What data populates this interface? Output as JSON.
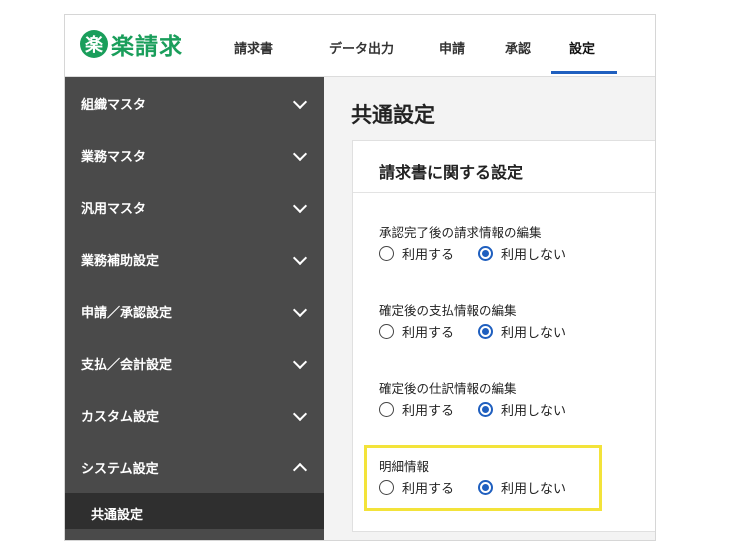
{
  "app": {
    "logo_mark": "楽",
    "logo_text": "楽請求",
    "brand_color": "#1a9e5b",
    "accent_color": "#1f5fbf"
  },
  "nav": {
    "items": [
      {
        "label": "請求書"
      },
      {
        "label": "データ出力"
      },
      {
        "label": "申請"
      },
      {
        "label": "承認"
      },
      {
        "label": "設定",
        "active": true
      }
    ]
  },
  "sidebar": {
    "items": [
      {
        "label": "組織マスタ",
        "icon": "chevron-down-icon"
      },
      {
        "label": "業務マスタ",
        "icon": "chevron-down-icon"
      },
      {
        "label": "汎用マスタ",
        "icon": "chevron-down-icon"
      },
      {
        "label": "業務補助設定",
        "icon": "chevron-down-icon"
      },
      {
        "label": "申請／承認設定",
        "icon": "chevron-down-icon"
      },
      {
        "label": "支払／会計設定",
        "icon": "chevron-down-icon"
      },
      {
        "label": "カスタム設定",
        "icon": "chevron-down-icon"
      },
      {
        "label": "システム設定",
        "icon": "chevron-up-icon",
        "expanded": true
      }
    ],
    "sub_items": [
      {
        "label": "共通設定",
        "active": true
      }
    ]
  },
  "main": {
    "title": "共通設定",
    "card": {
      "title": "請求書に関する設定",
      "settings": [
        {
          "label": "承認完了後の請求情報の編集",
          "options": [
            "利用する",
            "利用しない"
          ],
          "selected": "利用しない"
        },
        {
          "label": "確定後の支払情報の編集",
          "options": [
            "利用する",
            "利用しない"
          ],
          "selected": "利用しない"
        },
        {
          "label": "確定後の仕訳情報の編集",
          "options": [
            "利用する",
            "利用しない"
          ],
          "selected": "利用しない"
        },
        {
          "label": "明細情報",
          "options": [
            "利用する",
            "利用しない"
          ],
          "selected": "利用しない",
          "highlighted": true
        }
      ]
    }
  },
  "highlight_color": "#f3e33a"
}
